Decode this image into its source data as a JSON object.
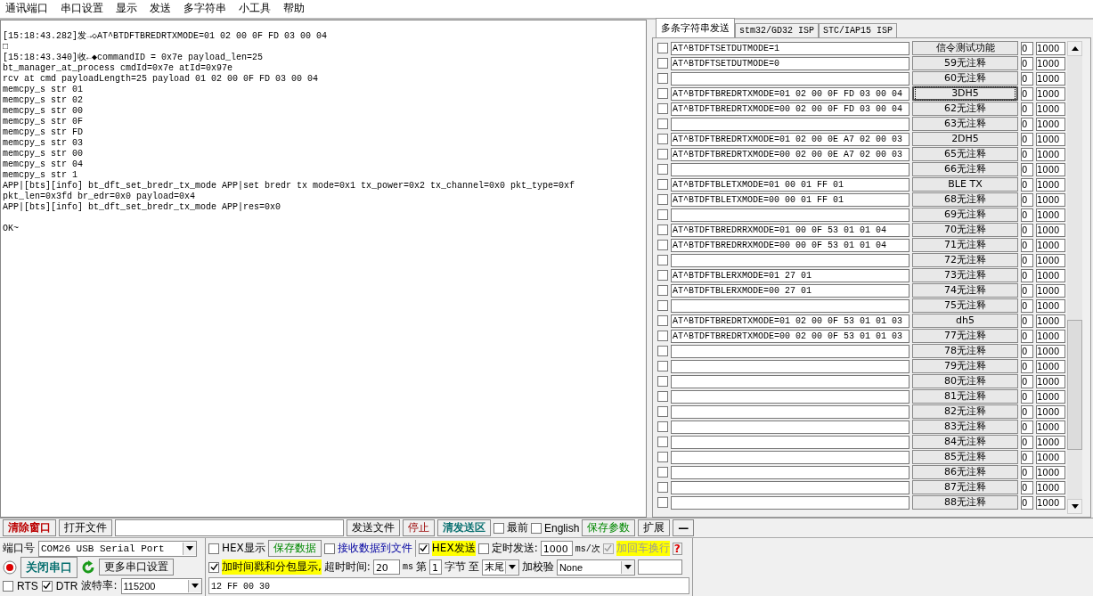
{
  "menu": [
    "通讯端口",
    "串口设置",
    "显示",
    "发送",
    "多字符串",
    "小工具",
    "帮助"
  ],
  "log": {
    "lines": [
      "[15:18:43.282]发→◇AT^BTDFTBREDRTXMODE=01 02 00 0F FD 03 00 04",
      "□",
      "[15:18:43.340]收←◆commandID = 0x7e payload_len=25",
      "bt_manager_at_process cmdId=0x7e atId=0x97e",
      "rcv at cmd payloadLength=25 payload 01 02 00 0F FD 03 00 04",
      "memcpy_s str 01",
      "memcpy_s str 02",
      "memcpy_s str 00",
      "memcpy_s str 0F",
      "memcpy_s str FD",
      "memcpy_s str 03",
      "memcpy_s str 00",
      "memcpy_s str 04",
      "memcpy_s str 1",
      "APP|[bts][info] bt_dft_set_bredr_tx_mode APP|set bredr tx mode=0x1 tx_power=0x2 tx_channel=0x0 pkt_type=0xf",
      "pkt_len=0x3fd br_edr=0x0 payload=0x4",
      "APP|[bts][info] bt_dft_set_bredr_tx_mode APP|res=0x0"
    ],
    "reply": "OK~"
  },
  "tabs": [
    {
      "label": "多条字符串发送",
      "selected": true
    },
    {
      "label": "stm32/GD32 ISP",
      "selected": false
    },
    {
      "label": "STC/IAP15 ISP",
      "selected": false
    }
  ],
  "rows": [
    {
      "checked": false,
      "command": "AT^BTDFTSETDUTMODE=1",
      "label": "信令测试功能",
      "focused": false,
      "count": "0",
      "interval": "1000"
    },
    {
      "checked": false,
      "command": "AT^BTDFTSETDUTMODE=0",
      "label": "59无注释",
      "focused": false,
      "count": "0",
      "interval": "1000"
    },
    {
      "checked": false,
      "label": "60无注释",
      "focused": false,
      "count": "0",
      "interval": "1000"
    },
    {
      "checked": false,
      "command": "AT^BTDFTBREDRTXMODE=01 02 00 0F FD 03 00 04",
      "label": "3DH5",
      "focused": true,
      "count": "0",
      "interval": "1000"
    },
    {
      "checked": false,
      "command": "AT^BTDFTBREDRTXMODE=00 02 00 0F FD 03 00 04",
      "label": "62无注释",
      "focused": false,
      "count": "0",
      "interval": "1000"
    },
    {
      "checked": false,
      "label": "63无注释",
      "focused": false,
      "count": "0",
      "interval": "1000"
    },
    {
      "checked": false,
      "command": "AT^BTDFTBREDRTXMODE=01 02 00 0E A7 02 00 03",
      "label": "2DH5",
      "focused": false,
      "count": "0",
      "interval": "1000"
    },
    {
      "checked": false,
      "command": "AT^BTDFTBREDRTXMODE=00 02 00 0E A7 02 00 03",
      "label": "65无注释",
      "focused": false,
      "count": "0",
      "interval": "1000"
    },
    {
      "checked": false,
      "label": "66无注释",
      "focused": false,
      "count": "0",
      "interval": "1000"
    },
    {
      "checked": false,
      "command": "AT^BTDFTBLETXMODE=01 00 01 FF 01",
      "label": "BLE TX",
      "focused": false,
      "count": "0",
      "interval": "1000"
    },
    {
      "checked": false,
      "command": "AT^BTDFTBLETXMODE=00 00 01 FF 01",
      "label": "68无注释",
      "focused": false,
      "count": "0",
      "interval": "1000"
    },
    {
      "checked": false,
      "label": "69无注释",
      "focused": false,
      "count": "0",
      "interval": "1000"
    },
    {
      "checked": false,
      "command": "AT^BTDFTBREDRRXMODE=01 00 0F 53 01 01 04",
      "label": "70无注释",
      "focused": false,
      "count": "0",
      "interval": "1000"
    },
    {
      "checked": false,
      "command": "AT^BTDFTBREDRRXMODE=00 00 0F 53 01 01 04",
      "label": "71无注释",
      "focused": false,
      "count": "0",
      "interval": "1000"
    },
    {
      "checked": false,
      "label": "72无注释",
      "focused": false,
      "count": "0",
      "interval": "1000"
    },
    {
      "checked": false,
      "command": "AT^BTDFTBLERXMODE=01 27 01",
      "label": "73无注释",
      "focused": false,
      "count": "0",
      "interval": "1000"
    },
    {
      "checked": false,
      "command": "AT^BTDFTBLERXMODE=00 27 01",
      "label": "74无注释",
      "focused": false,
      "count": "0",
      "interval": "1000"
    },
    {
      "checked": false,
      "label": "75无注释",
      "focused": false,
      "count": "0",
      "interval": "1000"
    },
    {
      "checked": false,
      "command": "AT^BTDFTBREDRTXMODE=01 02 00 0F 53 01 01 03",
      "label": "dh5",
      "focused": false,
      "count": "0",
      "interval": "1000"
    },
    {
      "checked": false,
      "command": "AT^BTDFTBREDRTXMODE=00 02 00 0F 53 01 01 03",
      "label": "77无注释",
      "focused": false,
      "count": "0",
      "interval": "1000"
    },
    {
      "checked": false,
      "label": "78无注释",
      "focused": false,
      "count": "0",
      "interval": "1000"
    },
    {
      "checked": false,
      "label": "79无注释",
      "focused": false,
      "count": "0",
      "interval": "1000"
    },
    {
      "checked": false,
      "label": "80无注释",
      "focused": false,
      "count": "0",
      "interval": "1000"
    },
    {
      "checked": false,
      "label": "81无注释",
      "focused": false,
      "count": "0",
      "interval": "1000"
    },
    {
      "checked": false,
      "label": "82无注释",
      "focused": false,
      "count": "0",
      "interval": "1000"
    },
    {
      "checked": false,
      "label": "83无注释",
      "focused": false,
      "count": "0",
      "interval": "1000"
    },
    {
      "checked": false,
      "label": "84无注释",
      "focused": false,
      "count": "0",
      "interval": "1000"
    },
    {
      "checked": false,
      "label": "85无注释",
      "focused": false,
      "count": "0",
      "interval": "1000"
    },
    {
      "checked": false,
      "label": "86无注释",
      "focused": false,
      "count": "0",
      "interval": "1000"
    },
    {
      "checked": false,
      "label": "87无注释",
      "focused": false,
      "count": "0",
      "interval": "1000"
    },
    {
      "checked": false,
      "label": "88无注释",
      "focused": false,
      "count": "0",
      "interval": "1000"
    }
  ],
  "toolbar": {
    "clear": "清除窗口",
    "open_file": "打开文件",
    "send_file": "发送文件",
    "stop": "停止",
    "clear_send": "清发送区",
    "topmost": {
      "label": "最前",
      "checked": false
    },
    "english": {
      "label": "English",
      "checked": false
    },
    "save_params": "保存参数",
    "expand": "扩展",
    "collapse": "—"
  },
  "port": {
    "label": "端口号",
    "value": "COM26 USB Serial Port",
    "close_button": "关闭串口",
    "more_settings": "更多串口设置",
    "rts": {
      "label": "RTS",
      "checked": false
    },
    "dtr": {
      "label": "DTR",
      "checked": true
    },
    "baud_label": "波特率:",
    "baud": "115200"
  },
  "send": {
    "hex_display": {
      "label": "HEX显示",
      "checked": false
    },
    "save_data": "保存数据",
    "receive_to_file": {
      "label": "接收数据到文件",
      "checked": false
    },
    "hex_send": {
      "label": "HEX发送",
      "checked": true
    },
    "timed_send": {
      "label": "定时发送:",
      "checked": false
    },
    "period": "1000",
    "period_unit": "ms/次",
    "append_crlf": {
      "label": "加回车换行",
      "checked": true,
      "disabled": true
    },
    "help": "?",
    "timestamp": {
      "label": "加时间戳和分包显示,",
      "checked": true
    },
    "timeout_label": "超时时间:",
    "timeout": "20",
    "timeout_unit": "ms",
    "from_label": "第",
    "from": "1",
    "byte_label": "字节",
    "to_label": "至",
    "to": "末尾",
    "checksum_label": "加校验",
    "checksum": "None",
    "text": "12 FF 00 30"
  }
}
